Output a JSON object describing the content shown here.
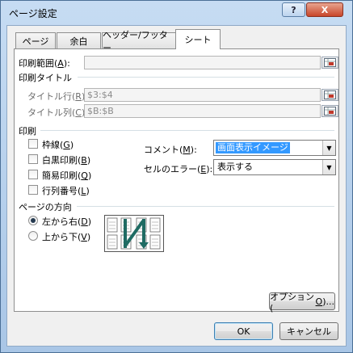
{
  "window": {
    "title": "ページ設定",
    "help_label": "?",
    "close_label": "X"
  },
  "tabs": [
    {
      "label": "ページ"
    },
    {
      "label": "余白"
    },
    {
      "label": "ヘッダー/フッター"
    },
    {
      "label": "シート"
    }
  ],
  "print_area": {
    "label": "印刷範囲(",
    "key": "A",
    "suffix": "):",
    "value": ""
  },
  "print_titles": {
    "heading": "印刷タイトル",
    "rows": {
      "label": "タイトル行(",
      "key": "R",
      "suffix": "):",
      "value": "$3:$4"
    },
    "cols": {
      "label": "タイトル列(",
      "key": "C",
      "suffix": "):",
      "value": "$B:$B"
    }
  },
  "print": {
    "heading": "印刷",
    "checks": [
      {
        "label": "枠線(",
        "key": "G",
        "suffix": ")"
      },
      {
        "label": "白黒印刷(",
        "key": "B",
        "suffix": ")"
      },
      {
        "label": "簡易印刷(",
        "key": "Q",
        "suffix": ")"
      },
      {
        "label": "行列番号(",
        "key": "L",
        "suffix": ")"
      }
    ],
    "comments": {
      "label": "コメント(",
      "key": "M",
      "suffix": "):",
      "value": "画面表示イメージ"
    },
    "errors": {
      "label": "セルのエラー(",
      "key": "E",
      "suffix": "):",
      "value": "表示する"
    }
  },
  "page_order": {
    "heading": "ページの方向",
    "options": [
      {
        "label": "左から右(",
        "key": "D",
        "suffix": ")",
        "selected": true
      },
      {
        "label": "上から下(",
        "key": "V",
        "suffix": ")",
        "selected": false
      }
    ]
  },
  "buttons": {
    "options": "オプション(",
    "options_key": "O",
    "options_suffix": ")...",
    "ok": "OK",
    "cancel": "キャンセル"
  }
}
